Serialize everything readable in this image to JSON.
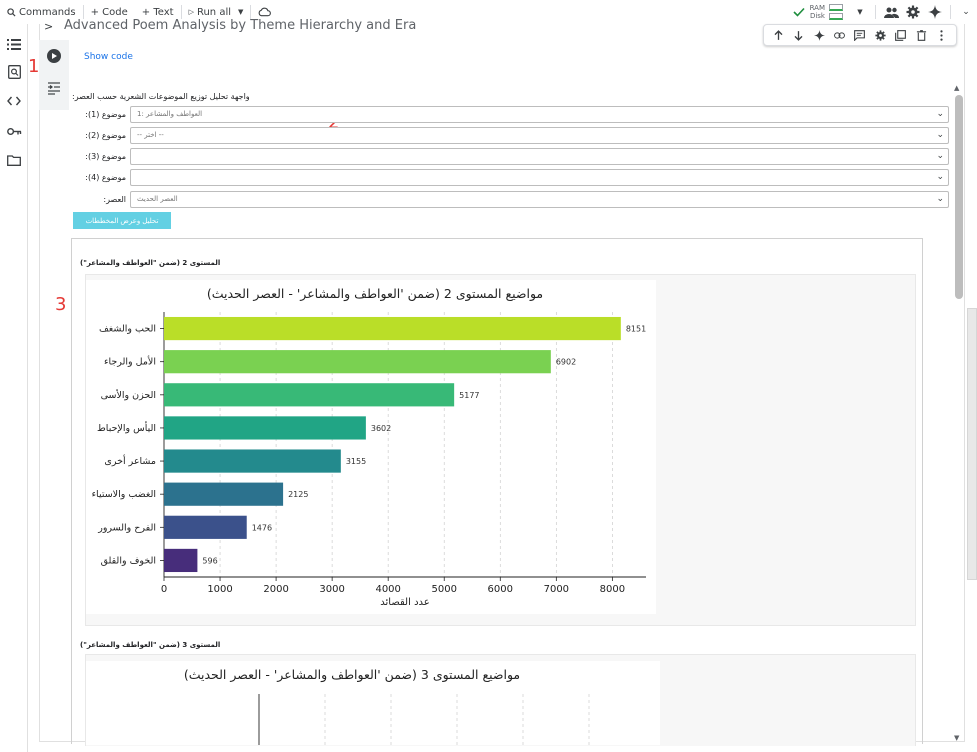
{
  "toolbar": {
    "commands": "Commands",
    "code": "+ Code",
    "text": "+ Text",
    "run_all": "Run all",
    "ram_label": "RAM",
    "disk_label": "Disk"
  },
  "cell": {
    "heading": "Advanced Poem Analysis by Theme Hierarchy and Era",
    "show_code": "Show code"
  },
  "annotations": [
    "1",
    "2",
    "3"
  ],
  "widget": {
    "title": "واجهة تحليل توزيع الموضوعات الشعرية حسب العصر:",
    "rows": [
      {
        "label": "موضوع (1):",
        "value": "العواطف والمشاعر :1"
      },
      {
        "label": "موضوع (2):",
        "value": "-- اختر --"
      },
      {
        "label": "موضوع (3):",
        "value": ""
      },
      {
        "label": "موضوع (4):",
        "value": ""
      },
      {
        "label": "العصر:",
        "value": "العصر الحديث"
      }
    ],
    "button": "تحليل وعرض المخططات"
  },
  "section1_label": "المستوى 2 (ضمن \"العواطف والمشاعر\")",
  "section2_label": "المستوى 3 (ضمن \"العواطف والمشاعر\")",
  "chart_data": [
    {
      "type": "bar",
      "orientation": "horizontal",
      "title": "مواضيع المستوى 2 (ضمن 'العواطف والمشاعر' - العصر الحديث)",
      "xlabel": "عدد القصائد",
      "ylabel": "",
      "categories": [
        "الحب والشغف",
        "الأمل والرجاء",
        "الحزن والأسى",
        "اليأس والإحباط",
        "مشاعر أخرى",
        "الغضب والاستياء",
        "الفرح والسرور",
        "الخوف والقلق"
      ],
      "values": [
        8151,
        6902,
        5177,
        3602,
        3155,
        2125,
        1476,
        596
      ],
      "colors": [
        "#bade28",
        "#7ad151",
        "#38b977",
        "#21a585",
        "#238a8d",
        "#2c728e",
        "#3b518b",
        "#472d7b"
      ],
      "xticks": [
        "0",
        "1000",
        "2000",
        "3000",
        "4000",
        "5000",
        "6000",
        "7000",
        "8000"
      ],
      "xlim": [
        0,
        8600
      ],
      "grid": "vertical dashed"
    },
    {
      "type": "bar",
      "orientation": "horizontal",
      "title": "مواضيع المستوى 3 (ضمن 'العواطف والمشاعر' - العصر الحديث)",
      "partially_visible": true
    }
  ]
}
